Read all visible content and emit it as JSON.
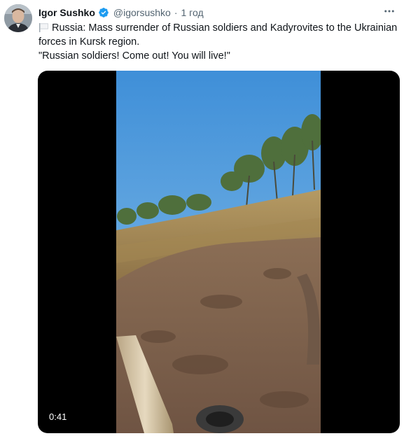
{
  "author": {
    "name": "Igor Sushko",
    "handle": "@igorsushko",
    "separator": "·",
    "time": "1 год"
  },
  "tweet": {
    "flag_icon": "white-flag-icon",
    "line1": "Russia: Mass surrender of Russian soldiers and Kadyrovites to the Ukrainian forces in Kursk region.",
    "line2": "\"Russian soldiers! Come out! You will live!\""
  },
  "media": {
    "duration": "0:41"
  },
  "colors": {
    "verified": "#1d9bf0",
    "secondary_text": "#536471"
  }
}
